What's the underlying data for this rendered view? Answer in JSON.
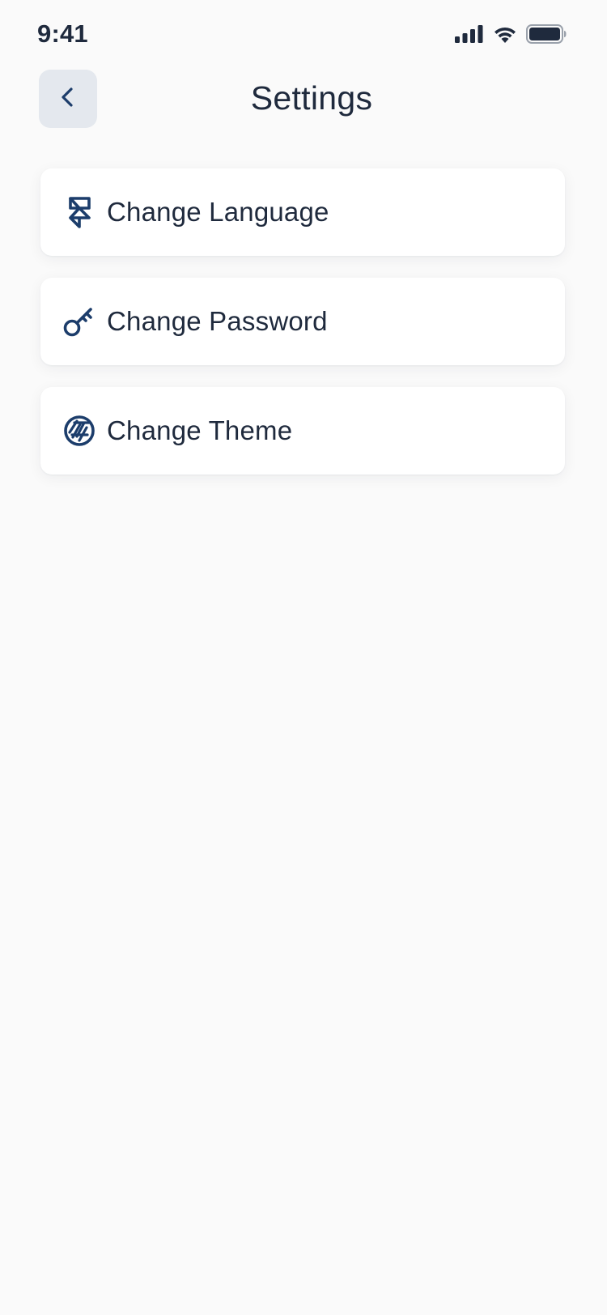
{
  "status_bar": {
    "time": "9:41"
  },
  "header": {
    "title": "Settings",
    "back_icon": "chevron-left-icon"
  },
  "settings": {
    "items": [
      {
        "label": "Change Language",
        "icon": "framer-icon"
      },
      {
        "label": "Change Password",
        "icon": "key-icon"
      },
      {
        "label": "Change Theme",
        "icon": "aperture-icon"
      }
    ]
  },
  "colors": {
    "background": "#fafafa",
    "card": "#ffffff",
    "text": "#1f2a3d",
    "icon": "#1c3d6b",
    "back_button_bg": "#e4e8ee"
  }
}
